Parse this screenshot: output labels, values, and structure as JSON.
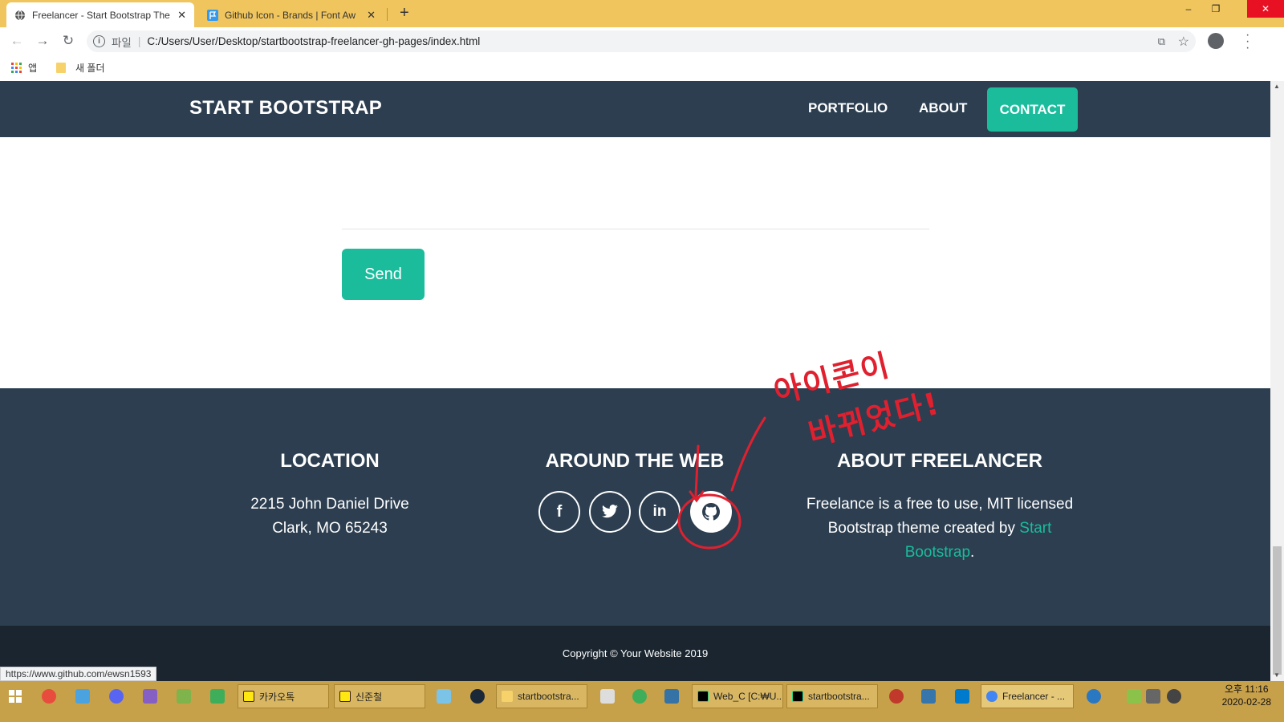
{
  "browser": {
    "tabs": [
      {
        "title": "Freelancer - Start Bootstrap The",
        "active": true
      },
      {
        "title": "Github Icon - Brands | Font Aw",
        "active": false
      }
    ],
    "new_tab": "+",
    "window_controls": {
      "minimize": "–",
      "restore": "❐",
      "close": "✕"
    },
    "nav": {
      "back": "←",
      "forward": "→",
      "reload": "↻"
    },
    "address": {
      "scheme": "파일",
      "url": "C:/Users/User/Desktop/startbootstrap-freelancer-gh-pages/index.html"
    },
    "bookmarks": [
      {
        "label": "앱",
        "icon": "apps-icon"
      },
      {
        "label": "새 폴더",
        "icon": "folder-icon"
      }
    ]
  },
  "site": {
    "brand": "START BOOTSTRAP",
    "nav": {
      "portfolio": "PORTFOLIO",
      "about": "ABOUT",
      "contact": "CONTACT"
    },
    "send_button": "Send",
    "footer": {
      "location": {
        "title": "LOCATION",
        "line1": "2215 John Daniel Drive",
        "line2": "Clark, MO 65243"
      },
      "around": {
        "title": "AROUND THE WEB",
        "icons": [
          "facebook-icon",
          "twitter-icon",
          "linkedin-icon",
          "github-icon"
        ]
      },
      "about": {
        "title": "ABOUT FREELANCER",
        "line1": "Freelance is a free to use, MIT licensed",
        "line2_pre": "Bootstrap theme created by",
        "link_part1": "Start",
        "link_part2": "Bootstrap",
        "suffix": "."
      }
    },
    "copyright": "Copyright © Your Website 2019"
  },
  "status_bar_url": "https://www.github.com/ewsn1593",
  "annotation": {
    "line1": "아이콘이",
    "line2": "바뀌었다!"
  },
  "taskbar": {
    "tasks": [
      "카카오톡",
      "신준철",
      "startbootstra...",
      "Web_C [C:₩U...",
      "startbootstra...",
      "Freelancer - ..."
    ],
    "clock": {
      "time": "오후 11:16",
      "date": "2020-02-28"
    }
  },
  "colors": {
    "navbar": "#2c3e50",
    "accent": "#1abc9c",
    "copyright_bg": "#1a252f",
    "annotation": "#e0202f",
    "tabstrip": "#f0c55e"
  }
}
